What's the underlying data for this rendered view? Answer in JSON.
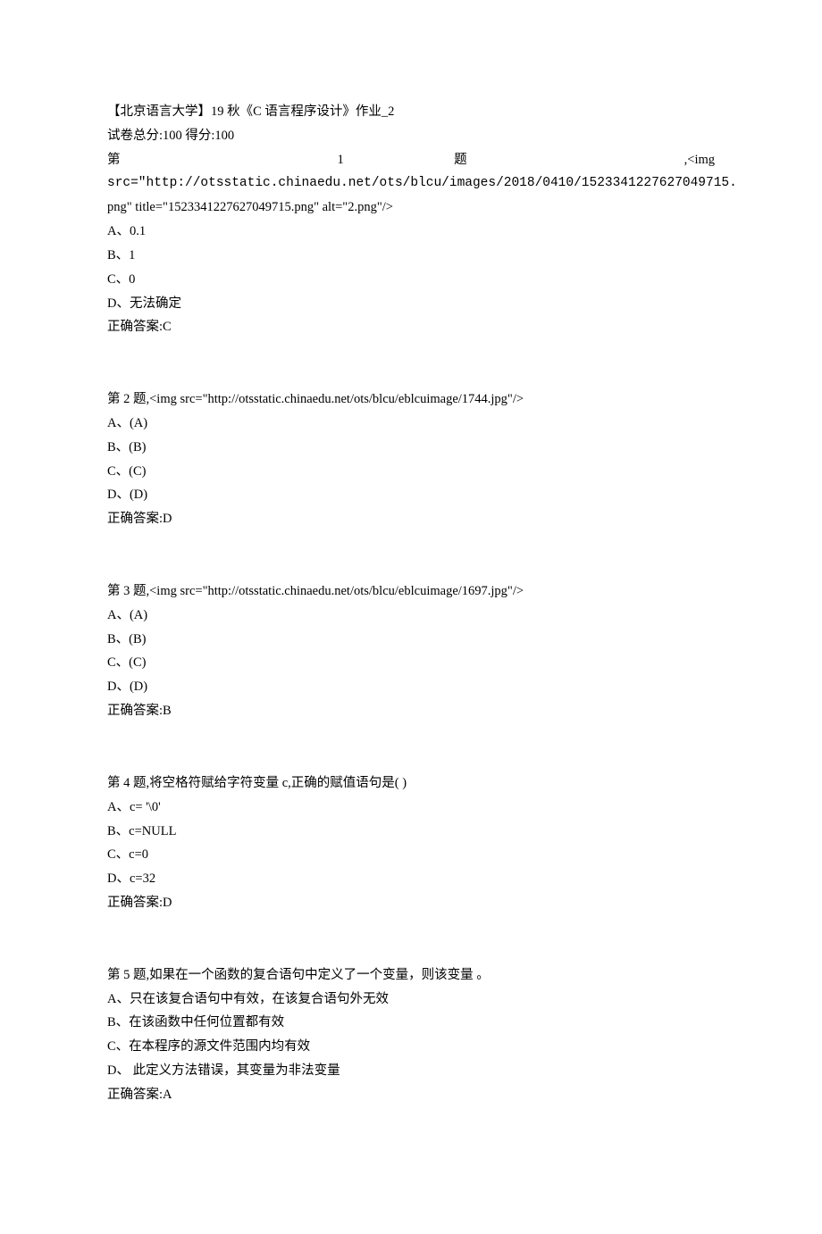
{
  "header": {
    "title": "【北京语言大学】19 秋《C 语言程序设计》作业_2",
    "score_line": "试卷总分:100    得分:100"
  },
  "q1": {
    "line1_a": "第",
    "line1_b": "1",
    "line1_c": "题",
    "line1_d": ",<img",
    "line2": "src=\"http://otsstatic.chinaedu.net/ots/blcu/images/2018/0410/1523341227627049715.",
    "line3": "png\" title=\"1523341227627049715.png\" alt=\"2.png\"/>",
    "optA": "A、0.1",
    "optB": "B、1",
    "optC": "C、0",
    "optD": "D、无法确定",
    "answer": "正确答案:C"
  },
  "q2": {
    "stem": "第 2 题,<img src=\"http://otsstatic.chinaedu.net/ots/blcu/eblcuimage/1744.jpg\"/>",
    "optA": "A、(A)",
    "optB": "B、(B)",
    "optC": "C、(C)",
    "optD": "D、(D)",
    "answer": "正确答案:D"
  },
  "q3": {
    "stem": "第 3 题,<img src=\"http://otsstatic.chinaedu.net/ots/blcu/eblcuimage/1697.jpg\"/>",
    "optA": "A、(A)",
    "optB": "B、(B)",
    "optC": "C、(C)",
    "optD": "D、(D)",
    "answer": "正确答案:B"
  },
  "q4": {
    "stem": "第 4 题,将空格符赋给字符变量 c,正确的赋值语句是(    )",
    "optA": "A、c= '\\0'",
    "optB": "B、c=NULL",
    "optC": "C、c=0",
    "optD": "D、c=32",
    "answer": "正确答案:D"
  },
  "q5": {
    "stem": "第 5 题,如果在一个函数的复合语句中定义了一个变量，则该变量        。",
    "optA": "A、只在该复合语句中有效，在该复合语句外无效",
    "optB": "B、在该函数中任何位置都有效",
    "optC": "C、在本程序的源文件范围内均有效",
    "optD": "D、 此定义方法错误，其变量为非法变量",
    "answer": "正确答案:A"
  }
}
